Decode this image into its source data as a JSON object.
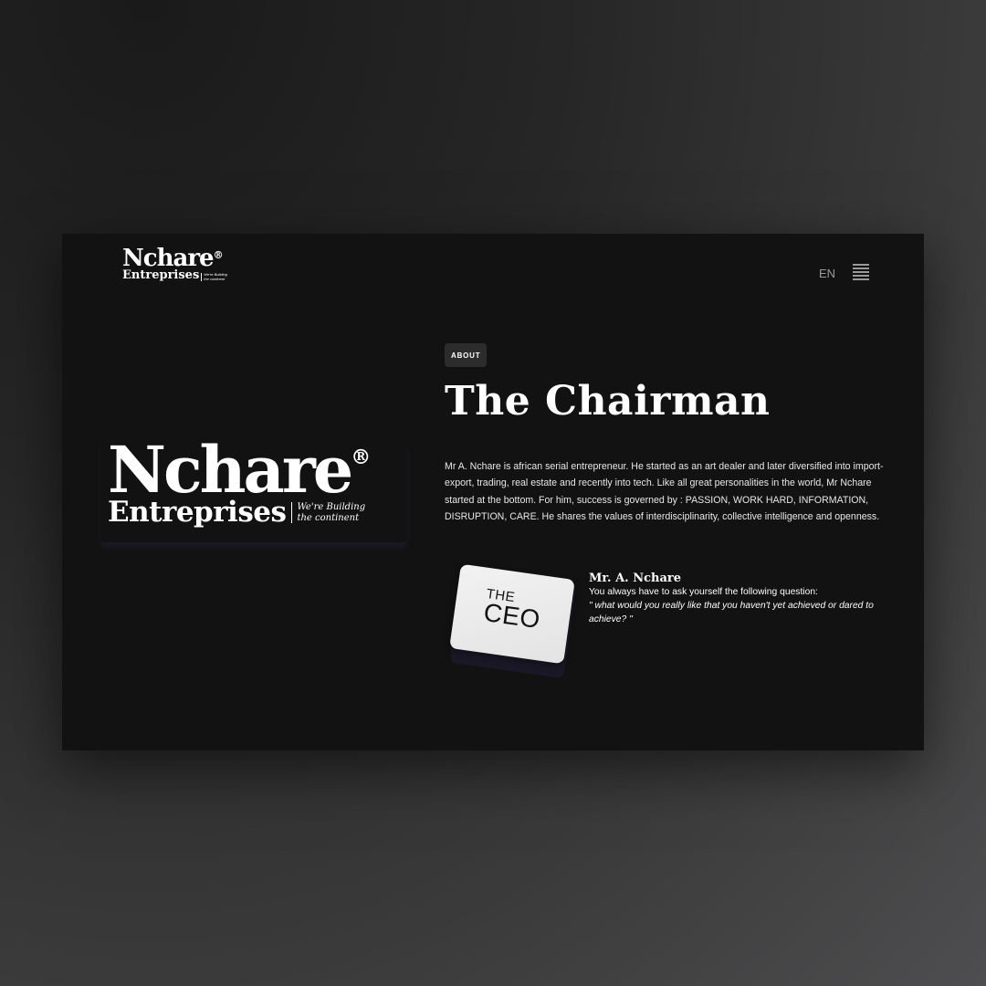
{
  "header": {
    "logo": {
      "line1": "Nchare",
      "registered": "®",
      "line2": "Entreprises",
      "tagline_1": "We're Building",
      "tagline_2": "the continent"
    },
    "language": "EN",
    "menu_icon": "hamburger-menu-icon"
  },
  "hero_logo": {
    "line1": "Nchare",
    "registered": "®",
    "line2": "Entreprises",
    "tagline_1": "We're Building",
    "tagline_2": "the continent"
  },
  "about": {
    "badge": "ABOUT",
    "title": "The Chairman",
    "bio": "Mr A. Nchare is african serial entrepreneur.  He started as an art dealer and later diversified into import-export, trading, real estate and recently into tech. Like all great personalities in the world, Mr Nchare started at the bottom. For him,  success is governed by : PASSION, WORK HARD, INFORMATION, DISRUPTION, CARE. He shares the values of interdisciplinarity, collective intelligence and openness."
  },
  "card": {
    "line1": "THE",
    "line2": "CEO"
  },
  "quote": {
    "name": "Mr. A. Nchare",
    "intro": "You always have to ask yourself the following question:",
    "text": "\" what would you really like that you haven't yet achieved or dared to achieve? \""
  },
  "colors": {
    "page_background": "#121212",
    "badge_background": "#2c2c2c",
    "text": "#ffffff",
    "muted": "#9a9a9a",
    "card": "#eeeeee"
  }
}
